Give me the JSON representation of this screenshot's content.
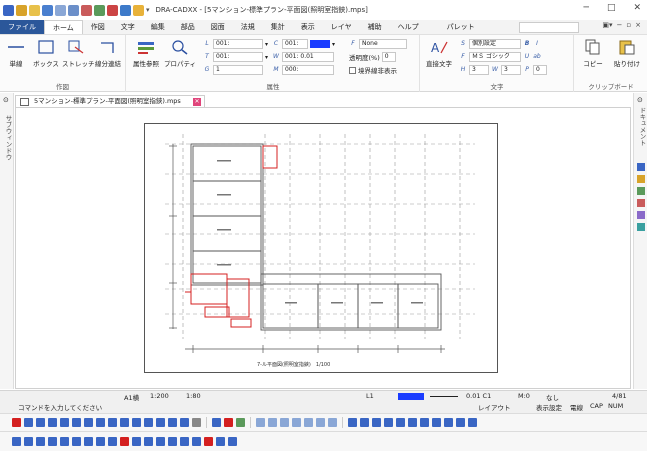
{
  "window": {
    "title": "DRA-CADXX - [5マンション-標準プラン-平面図(照明室指鋏).mps]",
    "controls": [
      "─",
      "□",
      "✕"
    ]
  },
  "menu": {
    "items": [
      "ファイル",
      "ホーム",
      "作図",
      "文字",
      "編集",
      "部品",
      "図面",
      "法規",
      "集計",
      "表示",
      "レイヤ",
      "補助",
      "ヘルプ",
      "パレット"
    ],
    "active": "ホーム"
  },
  "ribbon": {
    "sakuzu_group": {
      "label": "作図",
      "buttons": [
        "単線",
        "ボックス",
        "ストレッチ",
        "線分連結"
      ]
    },
    "property_group": {
      "label": "属性",
      "buttons": [
        "属性参照",
        "プロパティ"
      ],
      "layer_value": "001:",
      "line_value": "001:",
      "layer2_value": "1",
      "color_value": "001:",
      "width_value": "001: 0.01",
      "mode_value": "000:",
      "hatch_value": "None",
      "transparency_label": "透明度(%)",
      "transparency_value": "0",
      "check_label": "境界線非表示"
    },
    "text_group": {
      "label": "文字",
      "button": "直接文字",
      "size_setting": "個別設定",
      "font": "ＭＳ ゴシック",
      "height": "3",
      "width": "3",
      "spacing": "0"
    },
    "clipboard_group": {
      "label": "クリップボード",
      "buttons": [
        "コピー",
        "貼り付け"
      ]
    }
  },
  "side": {
    "left_label": "サブウィンドウ",
    "right_label": "ドキュメント"
  },
  "document_tab": {
    "title": "5マンション-標準プラン-平面図(照明室指鋏).mps"
  },
  "drawing": {
    "caption": "7-ル平面図(照明室指鋏)　1/100"
  },
  "status": {
    "a1_label": "A1横",
    "scale1": "1:200",
    "scale2": "1:80",
    "layer_code": "L1",
    "line_type": "0.01 C1",
    "mode": "M:0",
    "hatch": "なし",
    "count": "4/81",
    "prompt": "コマンドを入力してください",
    "layout": "レイアウト",
    "display_setting": "表示設定",
    "grid": "電線",
    "caps": "CAP",
    "num": "NUM"
  },
  "colors": {
    "file_menu_bg": "#2b579a",
    "drawing_red": "#d42020",
    "grid_gray": "#9a9a9a",
    "color_swatch": "#1a3cff"
  }
}
